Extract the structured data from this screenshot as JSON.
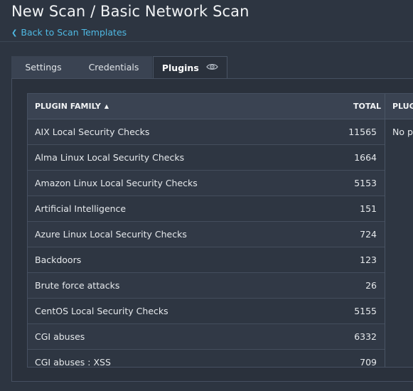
{
  "header": {
    "title": "New Scan / Basic Network Scan",
    "back_link": "Back to Scan Templates"
  },
  "tabs": [
    {
      "label": "Settings",
      "active": false
    },
    {
      "label": "Credentials",
      "active": false
    },
    {
      "label": "Plugins",
      "active": true,
      "icon": "eye-icon"
    }
  ],
  "table": {
    "columns": {
      "family": "PLUGIN FAMILY",
      "total": "TOTAL",
      "plugins": "PLUGI"
    },
    "sort": {
      "column": "family",
      "direction": "ascending"
    },
    "rows": [
      {
        "family": "AIX Local Security Checks",
        "total": "11565"
      },
      {
        "family": "Alma Linux Local Security Checks",
        "total": "1664"
      },
      {
        "family": "Amazon Linux Local Security Checks",
        "total": "5153"
      },
      {
        "family": "Artificial Intelligence",
        "total": "151"
      },
      {
        "family": "Azure Linux Local Security Checks",
        "total": "724"
      },
      {
        "family": "Backdoors",
        "total": "123"
      },
      {
        "family": "Brute force attacks",
        "total": "26"
      },
      {
        "family": "CentOS Local Security Checks",
        "total": "5155"
      },
      {
        "family": "CGI abuses",
        "total": "6332"
      },
      {
        "family": "CGI abuses : XSS",
        "total": "709"
      }
    ],
    "plugins_empty_text": "No pl"
  },
  "colors": {
    "background": "#2d3541",
    "link": "#4fb9e3",
    "header_row": "#3a4352"
  }
}
